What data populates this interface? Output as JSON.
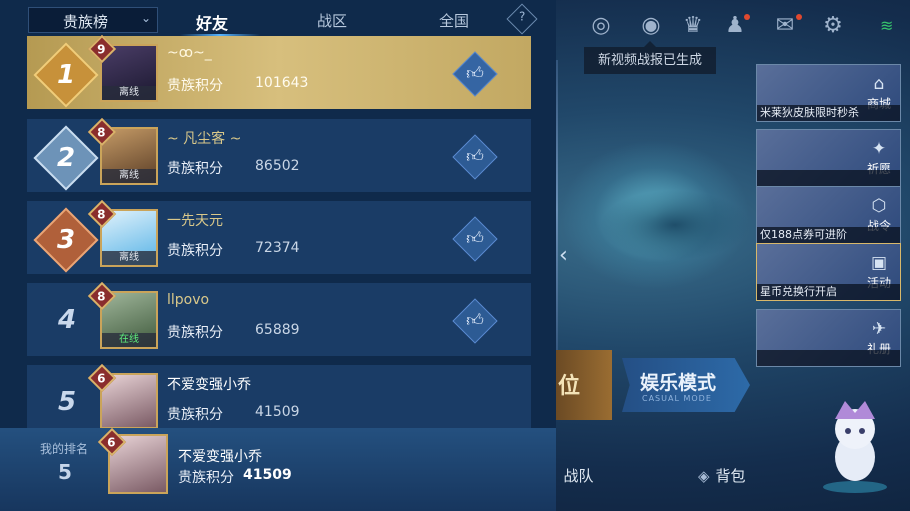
{
  "leaderboard": {
    "dropdown_label": "贵族榜",
    "tabs": [
      "好友",
      "战区",
      "全国"
    ],
    "help_symbol": "?",
    "score_label": "贵族积分",
    "entries": [
      {
        "rank": "1",
        "name": "~ꝏ~_",
        "vip": "9",
        "status": "离线",
        "score": "101643"
      },
      {
        "rank": "2",
        "name": "~ 凡尘客 ~",
        "vip": "8",
        "status": "离线",
        "score": "86502"
      },
      {
        "rank": "3",
        "name": "一先天元",
        "vip": "8",
        "status": "离线",
        "score": "72374"
      },
      {
        "rank": "4",
        "name": "llpovo",
        "vip": "8",
        "status": "在线",
        "score": "65889"
      },
      {
        "rank": "5",
        "name": "不爱变强小乔",
        "vip": "6",
        "status": "",
        "score": "41509"
      }
    ],
    "mine": {
      "label": "我的排名",
      "rank": "5",
      "name": "不爱变强小乔",
      "vip": "6",
      "score": "41509"
    }
  },
  "right": {
    "tooltip": "新视频战报已生成",
    "cards": [
      {
        "side": "商城",
        "caption": "米莱狄皮肤限时秒杀"
      },
      {
        "side": "祈愿",
        "caption": ""
      },
      {
        "side": "战令",
        "caption": "仅188点券可进阶"
      },
      {
        "side": "活动",
        "caption": "星币兑换行开启"
      },
      {
        "side": "礼册",
        "caption": ""
      }
    ],
    "mode_left": "位",
    "mode_title": "娱乐模式",
    "mode_sub": "CASUAL MODE",
    "team": "战队",
    "bag": "背包"
  },
  "colors": {
    "accent": "#56b4ff",
    "gold_row": "#c8ad68",
    "panel": "#0f2a4b"
  },
  "icons": [
    "target-icon",
    "eye-icon",
    "trophy-icon",
    "friends-icon",
    "mail-icon",
    "gear-icon",
    "signal-icon",
    "thumbs-up-icon"
  ]
}
